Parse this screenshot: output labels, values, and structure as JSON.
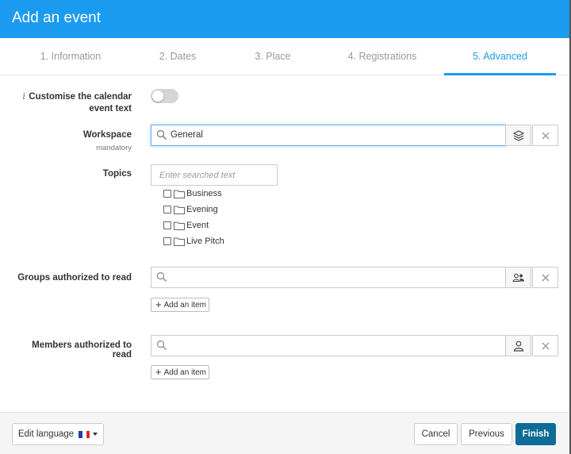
{
  "header": {
    "title": "Add an event"
  },
  "tabs": [
    {
      "label": "1. Information"
    },
    {
      "label": "2. Dates"
    },
    {
      "label": "3. Place"
    },
    {
      "label": "4. Registrations"
    },
    {
      "label": "5. Advanced",
      "active": true
    }
  ],
  "form": {
    "customise": {
      "info": "i",
      "line1": "Customise the calendar",
      "line2": "event text",
      "enabled": false
    },
    "workspace": {
      "label": "Workspace",
      "sublabel": "mandatory",
      "value": "General"
    },
    "topics": {
      "label": "Topics",
      "placeholder": "Enter searched text",
      "items": [
        "Business",
        "Evening",
        "Event",
        "Live Pitch"
      ]
    },
    "groups": {
      "label": "Groups authorized to read",
      "value": "",
      "add_label": "Add an item"
    },
    "members": {
      "label": "Members authorized to read",
      "value": "",
      "add_label": "Add an item"
    }
  },
  "footer": {
    "edit_language": "Edit language",
    "cancel": "Cancel",
    "previous": "Previous",
    "finish": "Finish"
  },
  "colors": {
    "brand": "#1a9bf0",
    "primary_button": "#0e6c96",
    "focus": "#66afe9"
  },
  "icons": [
    "search-icon",
    "layers-icon",
    "close-icon",
    "group-icon",
    "user-icon",
    "folder-icon",
    "flag-fr-icon",
    "caret-down-icon"
  ]
}
